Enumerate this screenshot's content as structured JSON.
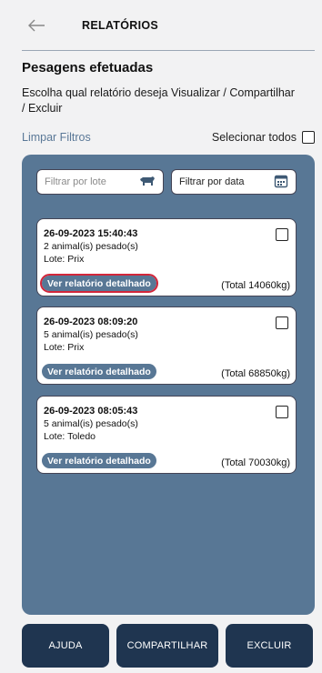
{
  "header": {
    "title": "RELATÓRIOS",
    "back_icon": "arrow-left-icon"
  },
  "section": {
    "title": "Pesagens efetuadas",
    "subtitle": "Escolha qual relatório deseja Visualizar / Compartilhar / Excluir"
  },
  "filters": {
    "clear_label": "Limpar Filtros",
    "select_all_label": "Selecionar todos",
    "lote_placeholder": "Filtrar por lote",
    "lote_icon": "cow-icon",
    "date_placeholder": "Filtrar por data",
    "date_icon": "calendar-icon"
  },
  "reports": [
    {
      "datetime": "26-09-2023 15:40:43",
      "animals": "2 animal(is) pesado(s)",
      "lote": "Lote: Prix",
      "button": "Ver relatório detalhado",
      "total": "(Total 14060kg)",
      "highlighted": true
    },
    {
      "datetime": "26-09-2023 08:09:20",
      "animals": "5 animal(is) pesado(s)",
      "lote": "Lote: Prix",
      "button": "Ver relatório detalhado",
      "total": "(Total 68850kg)",
      "highlighted": false
    },
    {
      "datetime": "26-09-2023 08:05:43",
      "animals": "5 animal(is) pesado(s)",
      "lote": "Lote: Toledo",
      "button": "Ver relatório detalhado",
      "total": "(Total 70030kg)",
      "highlighted": false
    }
  ],
  "actions": {
    "help": "AJUDA",
    "share": "COMPARTILHAR",
    "delete": "EXCLUIR"
  },
  "colors": {
    "accent": "#587795",
    "dark": "#1f3550",
    "highlight": "#d3263a"
  }
}
